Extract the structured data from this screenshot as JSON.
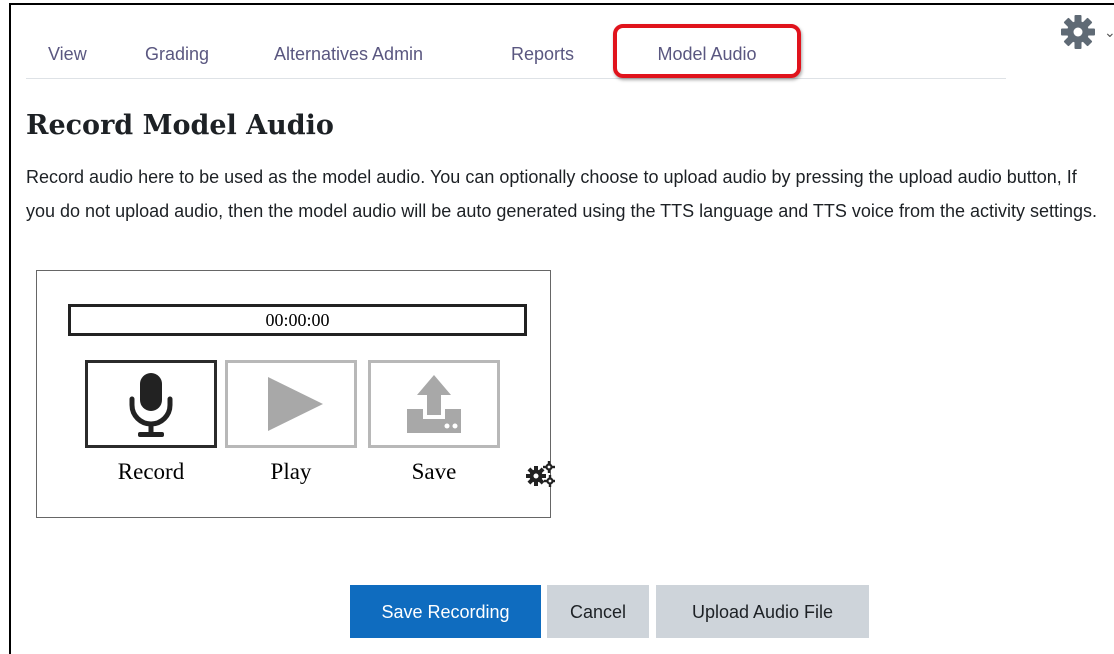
{
  "tabs": {
    "items": [
      {
        "label": "View"
      },
      {
        "label": "Grading"
      },
      {
        "label": "Alternatives Admin"
      },
      {
        "label": "Reports"
      },
      {
        "label": "Model Audio"
      }
    ],
    "active_highlight_color": "#e0131c"
  },
  "settings_menu": {
    "icon": "gear-icon",
    "caret": "⌄"
  },
  "page": {
    "title": "Record Model Audio",
    "description": "Record audio here to be used as the model audio. You can optionally choose to upload audio by pressing the upload audio button, If you do not upload audio, then the model audio will be auto generated using the TTS language and TTS voice from the activity settings."
  },
  "recorder": {
    "timer": "00:00:00",
    "record_label": "Record",
    "play_label": "Play",
    "save_label": "Save",
    "icons": {
      "record": "microphone-icon",
      "play": "play-icon",
      "save": "upload-icon",
      "settings": "gears-icon"
    }
  },
  "actions": {
    "save_recording": "Save Recording",
    "cancel": "Cancel",
    "upload_audio_file": "Upload Audio File"
  },
  "colors": {
    "primary": "#0f6cbf",
    "secondary": "#ced4da",
    "tab_text": "#5a5780"
  }
}
